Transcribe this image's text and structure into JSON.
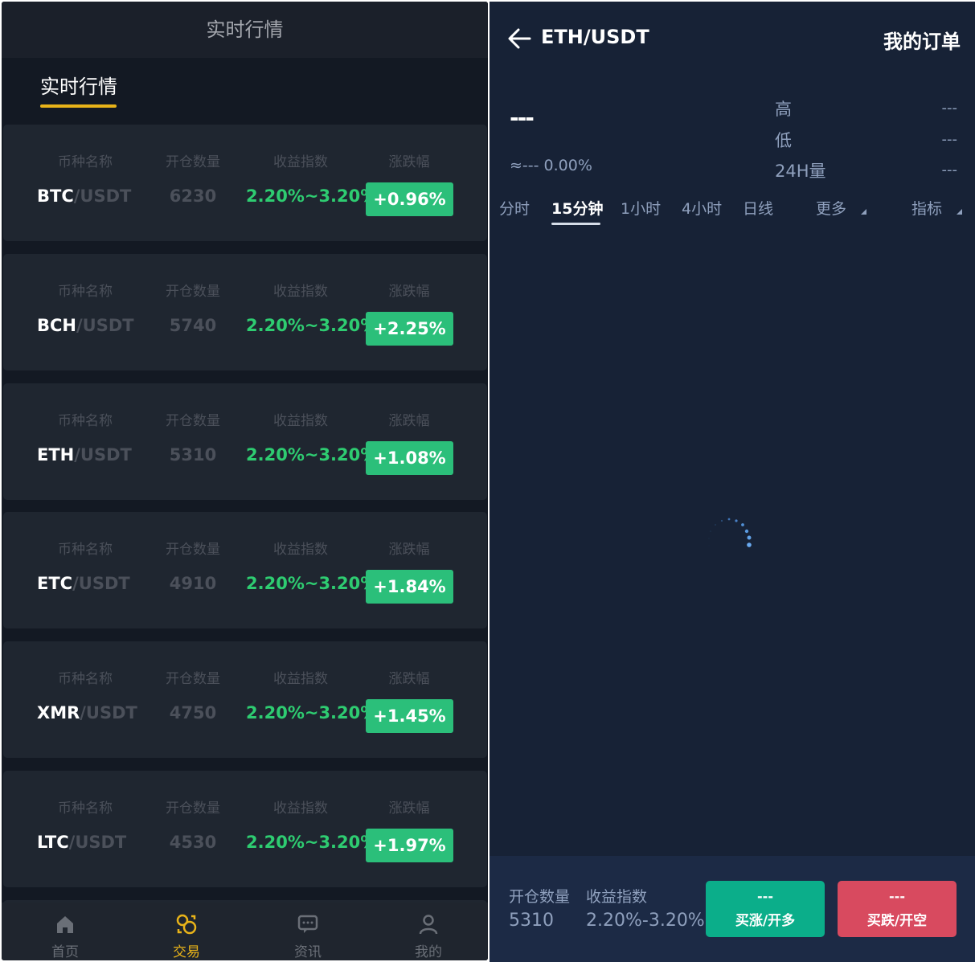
{
  "left": {
    "header_title": "实时行情",
    "subtab_label": "实时行情",
    "column_headers": {
      "name": "币种名称",
      "volume": "开仓数量",
      "index": "收益指数",
      "change": "涨跌幅"
    },
    "quote_suffix": "/USDT",
    "rows": [
      {
        "symbol": "BTC",
        "volume": "6230",
        "index": "2.20%~3.20%",
        "change": "+0.96%"
      },
      {
        "symbol": "BCH",
        "volume": "5740",
        "index": "2.20%~3.20%",
        "change": "+2.25%"
      },
      {
        "symbol": "ETH",
        "volume": "5310",
        "index": "2.20%~3.20%",
        "change": "+1.08%"
      },
      {
        "symbol": "ETC",
        "volume": "4910",
        "index": "2.20%~3.20%",
        "change": "+1.84%"
      },
      {
        "symbol": "XMR",
        "volume": "4750",
        "index": "2.20%~3.20%",
        "change": "+1.45%"
      },
      {
        "symbol": "LTC",
        "volume": "4530",
        "index": "2.20%~3.20%",
        "change": "+1.97%"
      }
    ],
    "bottom_nav": [
      {
        "label": "首页",
        "icon": "home-icon",
        "active": false
      },
      {
        "label": "交易",
        "icon": "trade-icon",
        "active": true
      },
      {
        "label": "资讯",
        "icon": "message-icon",
        "active": false
      },
      {
        "label": "我的",
        "icon": "user-icon",
        "active": false
      }
    ],
    "colors": {
      "accent": "#e8b319",
      "up": "#2ecc71",
      "badge": "#2bbf7a"
    }
  },
  "right": {
    "pair": "ETH/USDT",
    "my_orders": "我的订单",
    "price": "---",
    "approx": "≈--- 0.00%",
    "stats": [
      {
        "label": "高",
        "value": "---"
      },
      {
        "label": "低",
        "value": "---"
      },
      {
        "label": "24H量",
        "value": "---"
      }
    ],
    "timeframes": [
      "分时",
      "15分钟",
      "1小时",
      "4小时",
      "日线",
      "更多"
    ],
    "active_timeframe": "15分钟",
    "indicator_label": "指标",
    "order_bar": {
      "volume_label": "开仓数量",
      "index_label": "收益指数",
      "volume_value": "5310",
      "index_value": "2.20%-3.20%",
      "buy_long": {
        "value": "---",
        "label": "买涨/开多"
      },
      "buy_short": {
        "value": "---",
        "label": "买跌/开空"
      }
    },
    "colors": {
      "long": "#0bae8a",
      "short": "#d84a5f"
    }
  }
}
